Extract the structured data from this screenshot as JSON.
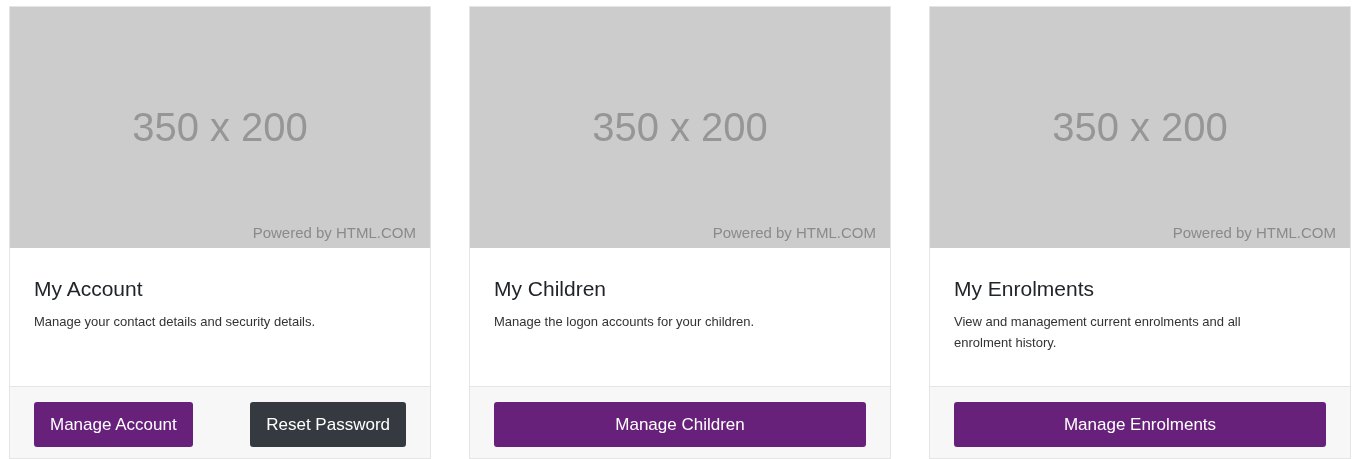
{
  "cards": [
    {
      "image": {
        "kind": "picture",
        "size_text": "350 x 200",
        "credit": "Powered by HTML.COM"
      },
      "title": "My Account",
      "description": "Manage your contact details and security details.",
      "buttons": [
        {
          "label": "Manage Account",
          "kind": "primary"
        },
        {
          "label": "Reset Password",
          "kind": "dark"
        }
      ]
    },
    {
      "image": {
        "kind": "picture",
        "size_text": "350 x 200",
        "credit": "Powered by HTML.COM"
      },
      "title": "My Children",
      "description": "Manage the logon accounts for your children.",
      "buttons": [
        {
          "label": "Manage Children",
          "kind": "primary"
        }
      ]
    },
    {
      "image": {
        "kind": "picture",
        "size_text": "350 x 200",
        "credit": "Powered by HTML.COM"
      },
      "title": "My Enrolments",
      "description": "View and management current enrolments and all enrolment history.",
      "buttons": [
        {
          "label": "Manage Enrolments",
          "kind": "primary"
        }
      ]
    }
  ]
}
